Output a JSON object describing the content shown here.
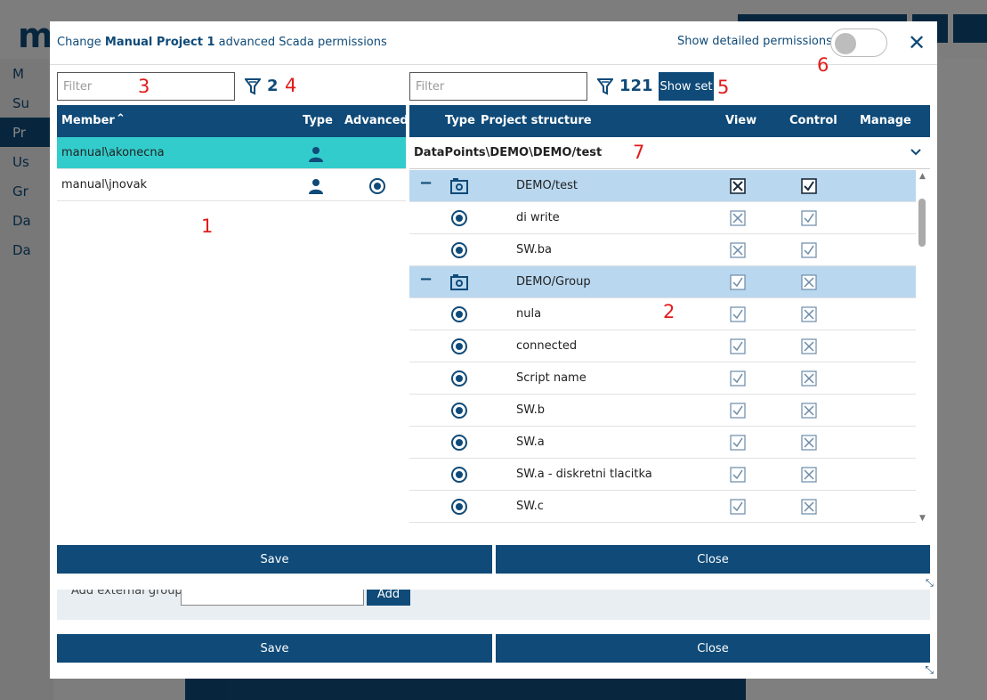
{
  "background": {
    "logo": "m",
    "sidebar_items": [
      "M",
      "Su",
      "Pr",
      "Us",
      "Gr",
      "Da",
      "Da"
    ],
    "outer_dialog": {
      "add_external_group_label": "Add external group",
      "add_button": "Add",
      "save_button": "Save",
      "close_button": "Close"
    }
  },
  "dialog": {
    "title_prefix": "Change ",
    "title_project": "Manual Project 1",
    "title_suffix": " advanced Scada permissions",
    "show_detailed_label": "Show detailed permissions",
    "show_detailed_enabled": false,
    "close_icon": "close-icon"
  },
  "left_panel": {
    "filter_placeholder": "Filter",
    "filter_icon": "funnel-icon",
    "count": "2",
    "columns": {
      "member": "Member",
      "type": "Type",
      "advanced": "Advanced"
    },
    "rows": [
      {
        "member": "manual\\akonecna",
        "type_icon": "user-icon",
        "advanced": false,
        "selected": true
      },
      {
        "member": "manual\\jnovak",
        "type_icon": "user-icon",
        "advanced": true,
        "selected": false
      }
    ]
  },
  "right_panel": {
    "filter_placeholder": "Filter",
    "filter_icon": "funnel-icon",
    "count": "121",
    "show_set_label": "Show set",
    "columns": {
      "type": "Type",
      "structure": "Project structure",
      "view": "View",
      "control": "Control",
      "manage": "Manage"
    },
    "path": "DataPoints\\DEMO\\DEMO/test",
    "rows": [
      {
        "kind": "group",
        "expander": "−",
        "type_icon": "camera-icon",
        "name": "DEMO/test",
        "view": "x-strong",
        "control": "check-strong"
      },
      {
        "kind": "item",
        "type_icon": "radio-icon",
        "name": "di write",
        "view": "x",
        "control": "check"
      },
      {
        "kind": "item",
        "type_icon": "radio-icon",
        "name": "SW.ba",
        "view": "x",
        "control": "check"
      },
      {
        "kind": "group",
        "expander": "−",
        "type_icon": "camera-icon",
        "name": "DEMO/Group",
        "view": "check",
        "control": "x"
      },
      {
        "kind": "item",
        "type_icon": "radio-icon",
        "name": "nula",
        "view": "check",
        "control": "x"
      },
      {
        "kind": "item",
        "type_icon": "radio-icon",
        "name": "connected",
        "view": "check",
        "control": "x"
      },
      {
        "kind": "item",
        "type_icon": "radio-icon",
        "name": "Script name",
        "view": "check",
        "control": "x"
      },
      {
        "kind": "item",
        "type_icon": "radio-icon",
        "name": "SW.b",
        "view": "check",
        "control": "x"
      },
      {
        "kind": "item",
        "type_icon": "radio-icon",
        "name": "SW.a",
        "view": "check",
        "control": "x"
      },
      {
        "kind": "item",
        "type_icon": "radio-icon",
        "name": "SW.a - diskretni tlacitka",
        "view": "check",
        "control": "x"
      },
      {
        "kind": "item",
        "type_icon": "radio-icon",
        "name": "SW.c",
        "view": "check",
        "control": "x"
      },
      {
        "kind": "item",
        "type_icon": "radio-icon",
        "name": "",
        "view": "check",
        "control": "x"
      }
    ]
  },
  "footer": {
    "save": "Save",
    "close": "Close"
  },
  "annotations": [
    "1",
    "2",
    "3",
    "4",
    "5",
    "6",
    "7"
  ],
  "colors": {
    "primary": "#0f4a78",
    "selected_row": "#33cccc",
    "group_row": "#b9d7ef",
    "annotation": "#e31a1a"
  }
}
